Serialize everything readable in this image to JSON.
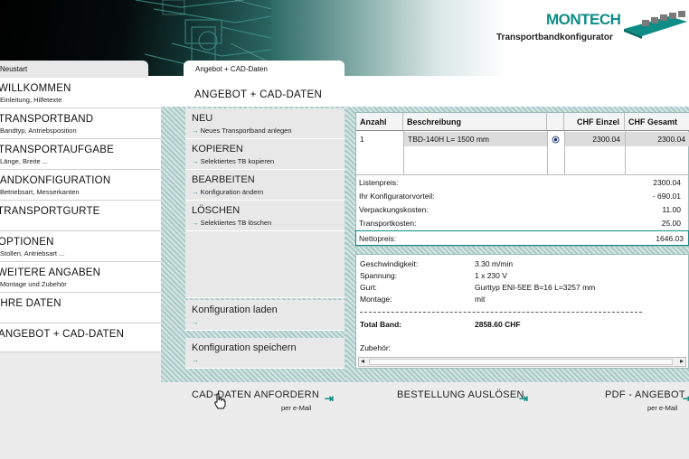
{
  "brand": {
    "logo": "MONTECH",
    "subtitle": "Transportbandkonfigurator"
  },
  "tabs": {
    "left": "Neustart",
    "active": "Angebot + CAD-Daten"
  },
  "nav": [
    {
      "title": "WILLKOMMEN",
      "sub": "Einleitung, Hilfetexte"
    },
    {
      "title": "TRANSPORTBAND",
      "sub": "Bandtyp, Antriebsposition"
    },
    {
      "title": "TRANSPORTAUFGABE",
      "sub": "Länge, Breite ..."
    },
    {
      "title": "BANDKONFIGURATION",
      "sub": "Betriebsart, Messerkanten"
    },
    {
      "title": "TRANSPORTGURTE",
      "sub": ""
    },
    {
      "title": "OPTIONEN",
      "sub": "Stollen, Antriebsart ..."
    },
    {
      "title": "WEITERE ANGABEN",
      "sub": "Montage und Zubehör"
    },
    {
      "title": "IHRE DATEN",
      "sub": ""
    },
    {
      "title": "ANGEBOT + CAD-DATEN",
      "sub": ""
    }
  ],
  "section_title": "ANGEBOT + CAD-DATEN",
  "actions": [
    {
      "title": "NEU",
      "sub": "Neues Transportband anlegen"
    },
    {
      "title": "KOPIEREN",
      "sub": "Selektiertes TB kopieren"
    },
    {
      "title": "BEARBEITEN",
      "sub": "Konfiguration ändern"
    },
    {
      "title": "LÖSCHEN",
      "sub": "Selektiertes TB löschen"
    },
    {
      "title": "Konfiguration laden",
      "sub": ""
    },
    {
      "title": "Konfiguration speichern",
      "sub": ""
    }
  ],
  "arrow": "→",
  "table": {
    "headers": [
      "Anzahl",
      "Beschreibung",
      "",
      "CHF Einzel",
      "CHF Gesamt"
    ],
    "rows": [
      {
        "anzahl": "1",
        "beschreibung": "TBD-140H L= 1500 mm",
        "einzel": "2300.04",
        "gesamt": "2300.04"
      }
    ]
  },
  "summary": [
    {
      "label": "Listenpreis:",
      "value": "2300.04"
    },
    {
      "label": "Ihr Konfiguratorvorteil:",
      "value": "- 690.01"
    },
    {
      "label": "Verpackungskosten:",
      "value": "11.00"
    },
    {
      "label": "Transportkosten:",
      "value": "25.00"
    }
  ],
  "netto": {
    "label": "Nettopreis:",
    "value": "1646.03"
  },
  "details": [
    {
      "label": "Geschwindigkeit:",
      "value": "3.30 m/min"
    },
    {
      "label": "Spannung:",
      "value": "1 x 230 V"
    },
    {
      "label": "Gurt:",
      "value": "Gurttyp ENI-5EE B=16 L=3257 mm"
    },
    {
      "label": "Montage:",
      "value": "mit"
    }
  ],
  "total": {
    "label": "Total Band:",
    "value": "2858.60 CHF"
  },
  "zubehoer": "Zubehör:",
  "bottom": {
    "cad": {
      "title": "CAD-DATEN ANFORDERN",
      "sub": "per e-Mail"
    },
    "bestellung": {
      "title": "BESTELLUNG AUSLÖSEN"
    },
    "pdf": {
      "title": "PDF - ANGEBOT",
      "sub": "per e-Mail"
    }
  },
  "colors": {
    "accent": "#0f8c86",
    "panel": "#e8e8e8",
    "hatch": "#a9c9c6"
  },
  "icons": [
    "enter-arrow-icon",
    "hand-cursor-icon",
    "radio-icon",
    "scroll-left-icon",
    "scroll-right-icon"
  ]
}
